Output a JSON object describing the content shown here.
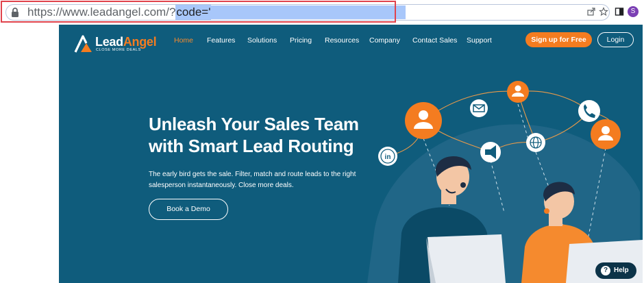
{
  "browser": {
    "url_prefix": "https://www.leadangel.com/?",
    "url_selected": "code='",
    "icons": [
      "lock-icon",
      "share-icon",
      "star-icon",
      "sidebar-icon"
    ],
    "profile_initial": "S"
  },
  "site": {
    "logo_brand_a": "Lead",
    "logo_brand_b": "Angel",
    "logo_tagline": "CLOSE MORE DEALS",
    "nav": [
      {
        "label": "Home",
        "active": true
      },
      {
        "label": "Features"
      },
      {
        "label": "Solutions"
      },
      {
        "label": "Pricing"
      },
      {
        "label": "Resources"
      },
      {
        "label": "Company"
      },
      {
        "label": "Contact Sales"
      },
      {
        "label": "Support"
      }
    ],
    "signup_label": "Sign up for Free",
    "login_label": "Login"
  },
  "hero": {
    "title_line1": "Unleash Your Sales Team",
    "title_line2": "with Smart Lead Routing",
    "subtitle_line1": "The early bird gets the sale. Filter, match and route leads to the right",
    "subtitle_line2": "salesperson instantaneously. Close more deals.",
    "cta_label": "Book a Demo"
  },
  "help": {
    "label": "Help"
  },
  "colors": {
    "page_bg": "#0f5c7c",
    "accent": "#f47c20",
    "highlight_box": "#e0434c",
    "url_selection": "#a8c7fa"
  }
}
